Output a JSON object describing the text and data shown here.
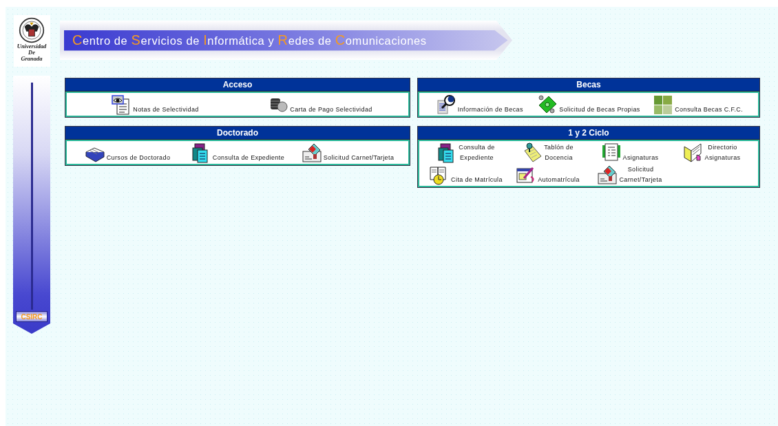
{
  "logo": {
    "lines": [
      "Universidad",
      "De",
      "Granada"
    ]
  },
  "sidebar": {
    "button": "CSIRC"
  },
  "banner": {
    "title": [
      {
        "kind": "initial",
        "text": "C"
      },
      {
        "kind": "plain",
        "text": "entro de "
      },
      {
        "kind": "initial",
        "text": "S"
      },
      {
        "kind": "plain",
        "text": "ervicios de "
      },
      {
        "kind": "initial",
        "text": "I"
      },
      {
        "kind": "plain",
        "text": "nformática y "
      },
      {
        "kind": "initial",
        "text": "R"
      },
      {
        "kind": "plain",
        "text": "edes de "
      },
      {
        "kind": "initial",
        "text": "C"
      },
      {
        "kind": "plain",
        "text": "omunicaciones"
      }
    ]
  },
  "left_column": [
    {
      "title": "Acceso",
      "items": [
        {
          "label": "Notas de Selectividad"
        },
        {
          "label": "Carta de Pago Selectividad"
        }
      ]
    },
    {
      "title": "Doctorado",
      "items": [
        {
          "label": "Cursos de Doctorado"
        },
        {
          "label": "Consulta de Expediente"
        },
        {
          "label": "Solicitud Carnet/Tarjeta"
        }
      ]
    }
  ],
  "right_column": [
    {
      "title": "Becas",
      "items": [
        {
          "label": "Información de Becas"
        },
        {
          "label": "Solicitud de Becas Propias"
        },
        {
          "label": "Consulta Becas C.F.C."
        }
      ]
    },
    {
      "title": "1 y 2 Ciclo",
      "items": [
        {
          "label": "Consulta de\nExpediente"
        },
        {
          "label": "Tablón de\nDocencia"
        },
        {
          "label": "Asignaturas"
        },
        {
          "label": "Directorio\nAsignaturas"
        },
        {
          "label": "Cita de Matrícula"
        },
        {
          "label": "Automatrícula"
        },
        {
          "label": "Solicitud\nCarnet/Tarjeta"
        }
      ]
    }
  ]
}
